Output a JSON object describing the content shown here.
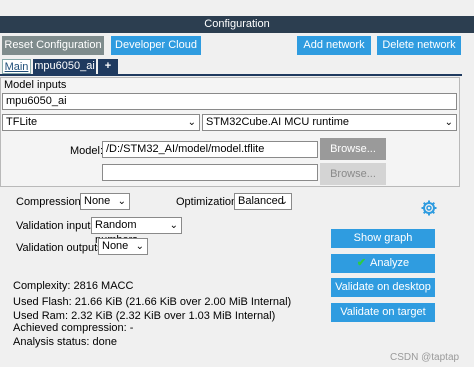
{
  "header": {
    "title": "Configuration"
  },
  "toolbar": {
    "reset": "Reset Configuration",
    "cloud": "Developer Cloud",
    "add_network": "Add network",
    "delete_network": "Delete network"
  },
  "tabs": {
    "main": "Main",
    "model": "mpu6050_ai",
    "add": "+"
  },
  "model_inputs": {
    "legend": "Model inputs",
    "name": "mpu6050_ai",
    "framework": "TFLite",
    "runtime": "STM32Cube.AI MCU runtime",
    "model_label": "Model:",
    "model_path": "/D:/STM32_AI/model/model.tflite",
    "browse1": "Browse...",
    "browse2": "Browse...",
    "second_path": ""
  },
  "settings": {
    "compression_label": "Compression:",
    "compression_value": "None",
    "optimization_label": "Optimization:",
    "optimization_value": "Balanced",
    "val_inputs_label": "Validation inputs:",
    "val_inputs_value": "Random numbers",
    "val_outputs_label": "Validation outputs:",
    "val_outputs_value": "None"
  },
  "actions": {
    "show_graph": "Show graph",
    "analyze": "Analyze",
    "validate_desktop": "Validate on desktop",
    "validate_target": "Validate on target"
  },
  "stats": {
    "complexity": "Complexity:  2816 MACC",
    "flash": "Used Flash: 21.66 KiB (21.66 KiB over 2.00 MiB Internal)",
    "ram": "Used Ram: 2.32 KiB (2.32 KiB over 1.03 MiB Internal)",
    "compression": "Achieved compression: -",
    "status": "Analysis status: done"
  },
  "watermark": "CSDN @taptap"
}
